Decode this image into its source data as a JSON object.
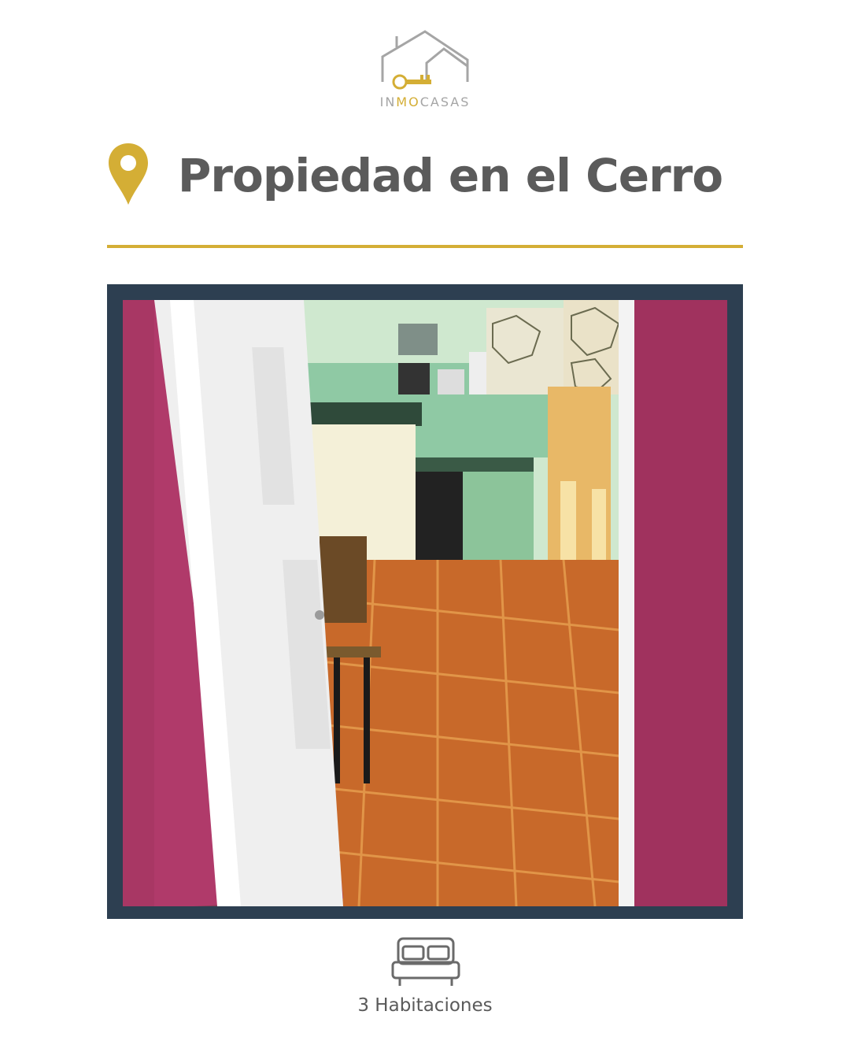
{
  "brand": {
    "logo_icon": "house-key-icon",
    "name_prefix": "IN",
    "name_highlight": "MO",
    "name_suffix": "CASAS",
    "accent_color": "#d4ae35",
    "logo_gray": "#a5a5a5"
  },
  "header": {
    "location_icon": "map-pin-icon",
    "title": "Propiedad en el Cerro"
  },
  "colors": {
    "accent": "#d4ae35",
    "frame": "#2d3f51",
    "text": "#5b5b5b"
  },
  "photo": {
    "subject": "property-interior-photo"
  },
  "features": {
    "bedrooms_icon": "bed-icon",
    "bedrooms_label": "3 Habitaciones"
  }
}
